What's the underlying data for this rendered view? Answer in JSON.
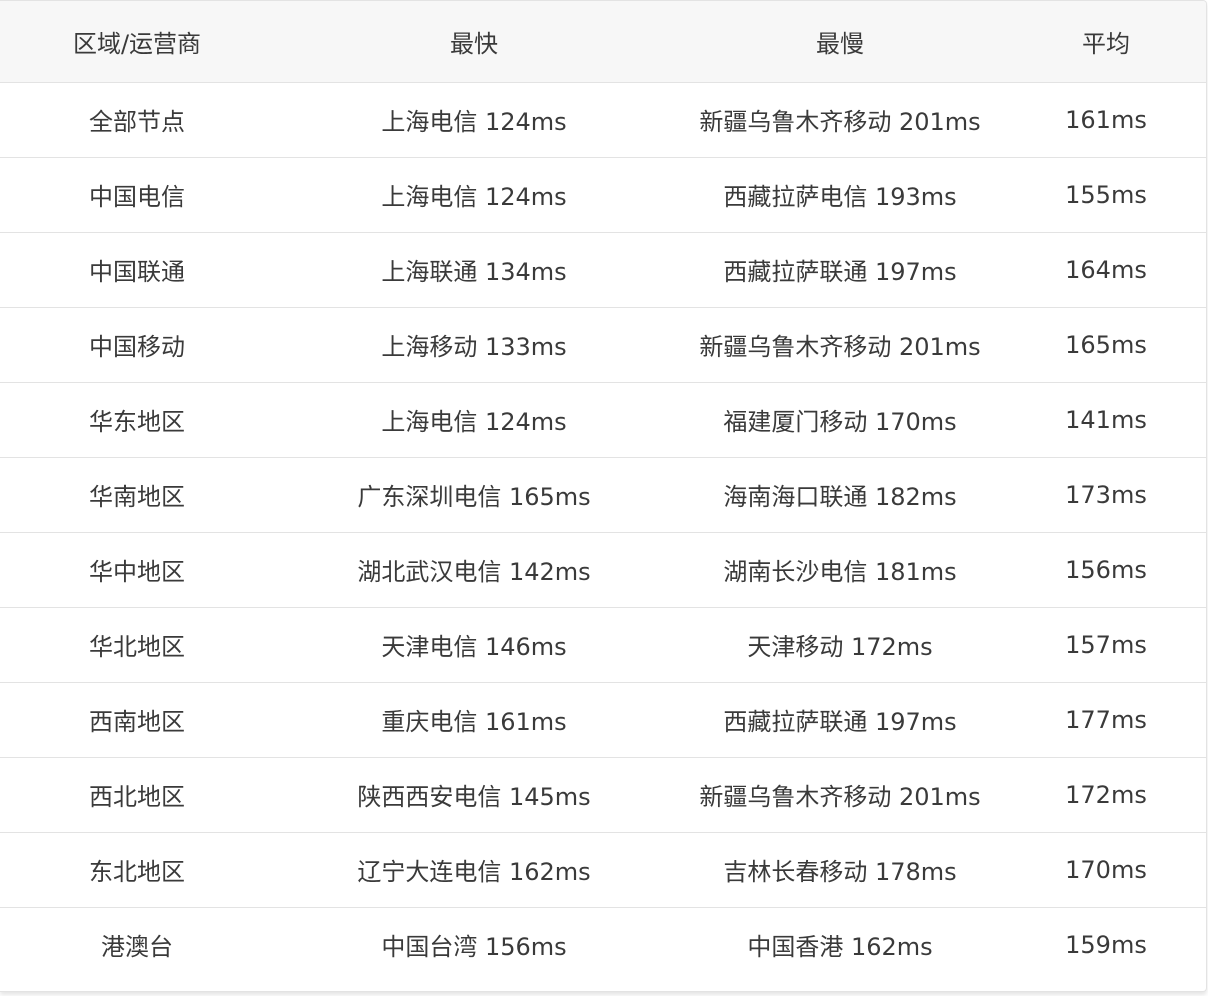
{
  "table": {
    "columns": [
      "区域/运营商",
      "最快",
      "最慢",
      "平均"
    ],
    "rows": [
      [
        "全部节点",
        "上海电信 124ms",
        "新疆乌鲁木齐移动 201ms",
        "161ms"
      ],
      [
        "中国电信",
        "上海电信 124ms",
        "西藏拉萨电信 193ms",
        "155ms"
      ],
      [
        "中国联通",
        "上海联通 134ms",
        "西藏拉萨联通 197ms",
        "164ms"
      ],
      [
        "中国移动",
        "上海移动 133ms",
        "新疆乌鲁木齐移动 201ms",
        "165ms"
      ],
      [
        "华东地区",
        "上海电信 124ms",
        "福建厦门移动 170ms",
        "141ms"
      ],
      [
        "华南地区",
        "广东深圳电信 165ms",
        "海南海口联通 182ms",
        "173ms"
      ],
      [
        "华中地区",
        "湖北武汉电信 142ms",
        "湖南长沙电信 181ms",
        "156ms"
      ],
      [
        "华北地区",
        "天津电信 146ms",
        "天津移动 172ms",
        "157ms"
      ],
      [
        "西南地区",
        "重庆电信 161ms",
        "西藏拉萨联通 197ms",
        "177ms"
      ],
      [
        "西北地区",
        "陕西西安电信 145ms",
        "新疆乌鲁木齐移动 201ms",
        "172ms"
      ],
      [
        "东北地区",
        "辽宁大连电信 162ms",
        "吉林长春移动 178ms",
        "170ms"
      ],
      [
        "港澳台",
        "中国台湾 156ms",
        "中国香港 162ms",
        "159ms"
      ]
    ]
  }
}
